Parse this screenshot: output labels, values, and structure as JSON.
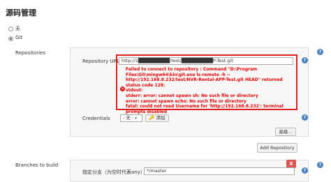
{
  "section_title": "源码管理",
  "scm_options": [
    {
      "label": "无",
      "selected": false
    },
    {
      "label": "Git",
      "selected": true
    }
  ],
  "repositories_label": "Repositories",
  "repository_url_label": "Repository URL",
  "repository_url_value": "http://1█████████/test/█████████P-Test.git",
  "error_message": "Failed to connect to repository : Command \"D:\\Program Files\\Git\\mingw64\\bin\\git.exe ls-remote -h -- http://192.168.8.232/test/NVR-Rental-APP-Test.git HEAD\" returned status code 128:\nstdout:\nstderr: error: cannot spawn sh: No such file or directory\nerror: cannot spawn echo: No such file or directory\nfatal: could not read Username for 'http://192.168.8.232': terminal prompts disabled",
  "error_icon": "error-icon",
  "credentials_label": "Credentials",
  "credentials_value": "- 无 -",
  "add_credentials_label": "添加",
  "advanced_button_label": "高级...",
  "add_repository_label": "Add Repository",
  "branches_label": "Branches to build",
  "branch_specifier_label": "指定分支（为空时代表any）",
  "branch_specifier_value": "*/master",
  "delete_label": "X",
  "help_label": "?",
  "colors": {
    "error": "#d00000",
    "error_border": "#e02020",
    "help": "#4a7fbf",
    "delete": "#d9534f"
  }
}
